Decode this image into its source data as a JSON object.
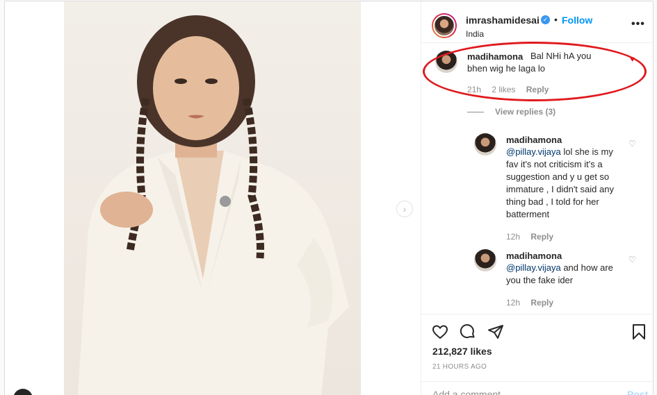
{
  "post": {
    "username": "imrashamidesai",
    "verified_mark": "✓",
    "separator": "•",
    "follow_label": "Follow",
    "location": "India",
    "more_label": "•••"
  },
  "comments": [
    {
      "username": "madihamona",
      "text": "Bal NHi hA you bhen wig he laga lo",
      "time": "21h",
      "likes": "2 likes",
      "reply_label": "Reply",
      "view_replies": "View replies (3)"
    }
  ],
  "replies": [
    {
      "username": "madihamona",
      "mention": "@pillay.vijaya",
      "text": " lol she is my fav it's not criticism it's a suggestion and y u get so immature , I didn't said any thing bad , I told for her batterment",
      "time": "12h",
      "reply_label": "Reply"
    },
    {
      "username": "madihamona",
      "mention": "@pillay.vijaya",
      "text": " and how are you the fake ider",
      "time": "12h",
      "reply_label": "Reply"
    }
  ],
  "footer": {
    "likes": "212,827 likes",
    "time": "21 HOURS AGO",
    "add_comment_placeholder": "Add a comment...",
    "post_label": "Post"
  },
  "icons": {
    "like": "heart-icon",
    "comment": "comment-icon",
    "share": "paper-plane-icon",
    "save": "bookmark-icon",
    "next": "chevron-right-icon"
  },
  "colors": {
    "follow": "#0095f6",
    "annotation_oval": "#e0191d",
    "mention": "#00376b"
  }
}
